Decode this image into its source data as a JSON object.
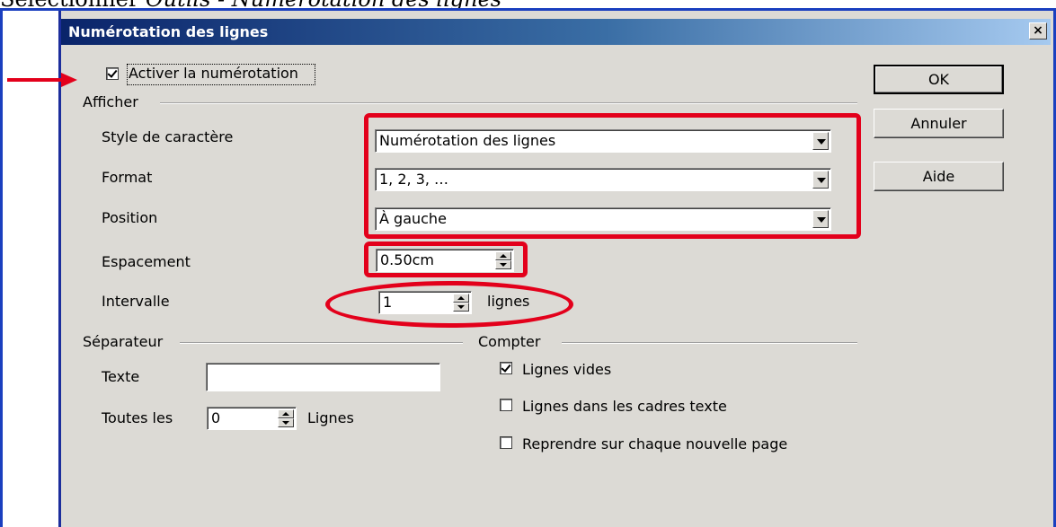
{
  "caption": {
    "prefix": "Sélectionner ",
    "italic": "Outils - Numérotation des lignes"
  },
  "dialog": {
    "title": "Numérotation des lignes",
    "close_glyph": "×"
  },
  "enable": {
    "label": "Activer la numérotation",
    "checked": true
  },
  "afficher": {
    "title": "Afficher",
    "style_label": "Style de caractère",
    "style_value": "Numérotation des lignes",
    "format_label": "Format",
    "format_value": "1, 2, 3, …",
    "position_label": "Position",
    "position_value": "À gauche",
    "spacing_label": "Espacement",
    "spacing_value": "0.50cm",
    "interval_label": "Intervalle",
    "interval_value": "1",
    "interval_unit": "lignes"
  },
  "separateur": {
    "title": "Séparateur",
    "text_label": "Texte",
    "text_value": "",
    "every_label": "Toutes les",
    "every_value": "0",
    "every_unit": "Lignes"
  },
  "compter": {
    "title": "Compter",
    "blank_lines_label": "Lignes vides",
    "blank_lines_checked": true,
    "text_frames_label": "Lignes dans les cadres texte",
    "text_frames_checked": false,
    "restart_label": "Reprendre sur chaque nouvelle page",
    "restart_checked": false
  },
  "buttons": {
    "ok": "OK",
    "cancel": "Annuler",
    "help": "Aide"
  },
  "colors": {
    "highlight": "#e3001b",
    "titlebar": "#0a246a",
    "dialog_bg": "#dcdad5"
  }
}
